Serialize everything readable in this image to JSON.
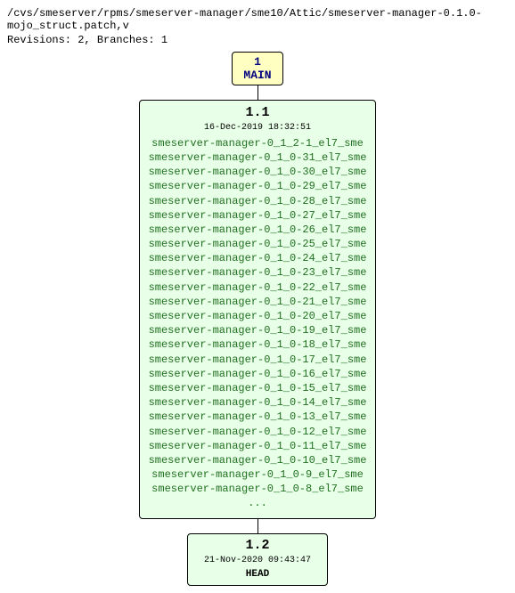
{
  "header": {
    "path": "/cvs/smeserver/rpms/smeserver-manager/sme10/Attic/smeserver-manager-0.1.0-mojo_struct.patch,v",
    "stats": "Revisions: 2, Branches: 1"
  },
  "main_node": {
    "rev": "1",
    "label": "MAIN"
  },
  "rev1": {
    "version": "1.1",
    "date": "16-Dec-2019 18:32:51",
    "tags": [
      "smeserver-manager-0_1_2-1_el7_sme",
      "smeserver-manager-0_1_0-31_el7_sme",
      "smeserver-manager-0_1_0-30_el7_sme",
      "smeserver-manager-0_1_0-29_el7_sme",
      "smeserver-manager-0_1_0-28_el7_sme",
      "smeserver-manager-0_1_0-27_el7_sme",
      "smeserver-manager-0_1_0-26_el7_sme",
      "smeserver-manager-0_1_0-25_el7_sme",
      "smeserver-manager-0_1_0-24_el7_sme",
      "smeserver-manager-0_1_0-23_el7_sme",
      "smeserver-manager-0_1_0-22_el7_sme",
      "smeserver-manager-0_1_0-21_el7_sme",
      "smeserver-manager-0_1_0-20_el7_sme",
      "smeserver-manager-0_1_0-19_el7_sme",
      "smeserver-manager-0_1_0-18_el7_sme",
      "smeserver-manager-0_1_0-17_el7_sme",
      "smeserver-manager-0_1_0-16_el7_sme",
      "smeserver-manager-0_1_0-15_el7_sme",
      "smeserver-manager-0_1_0-14_el7_sme",
      "smeserver-manager-0_1_0-13_el7_sme",
      "smeserver-manager-0_1_0-12_el7_sme",
      "smeserver-manager-0_1_0-11_el7_sme",
      "smeserver-manager-0_1_0-10_el7_sme",
      "smeserver-manager-0_1_0-9_el7_sme",
      "smeserver-manager-0_1_0-8_el7_sme"
    ],
    "ellipsis": "..."
  },
  "rev2": {
    "version": "1.2",
    "date": "21-Nov-2020 09:43:47",
    "head": "HEAD"
  }
}
